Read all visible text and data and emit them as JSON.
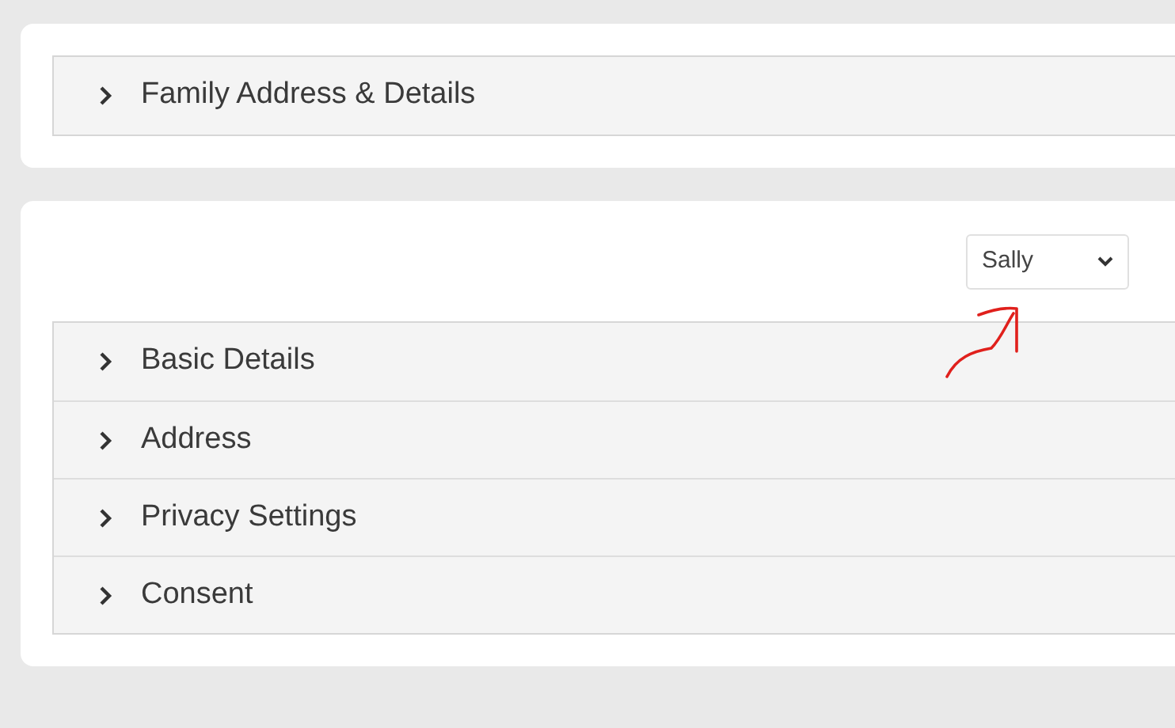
{
  "family_panel": {
    "sections": [
      {
        "title": "Family Address & Details",
        "expanded": false
      }
    ]
  },
  "member_panel": {
    "member_select": {
      "value": "Sally"
    },
    "sections": [
      {
        "title": "Basic Details",
        "expanded": false
      },
      {
        "title": "Address",
        "expanded": false
      },
      {
        "title": "Privacy Settings",
        "expanded": false
      },
      {
        "title": "Consent",
        "expanded": false
      }
    ]
  }
}
